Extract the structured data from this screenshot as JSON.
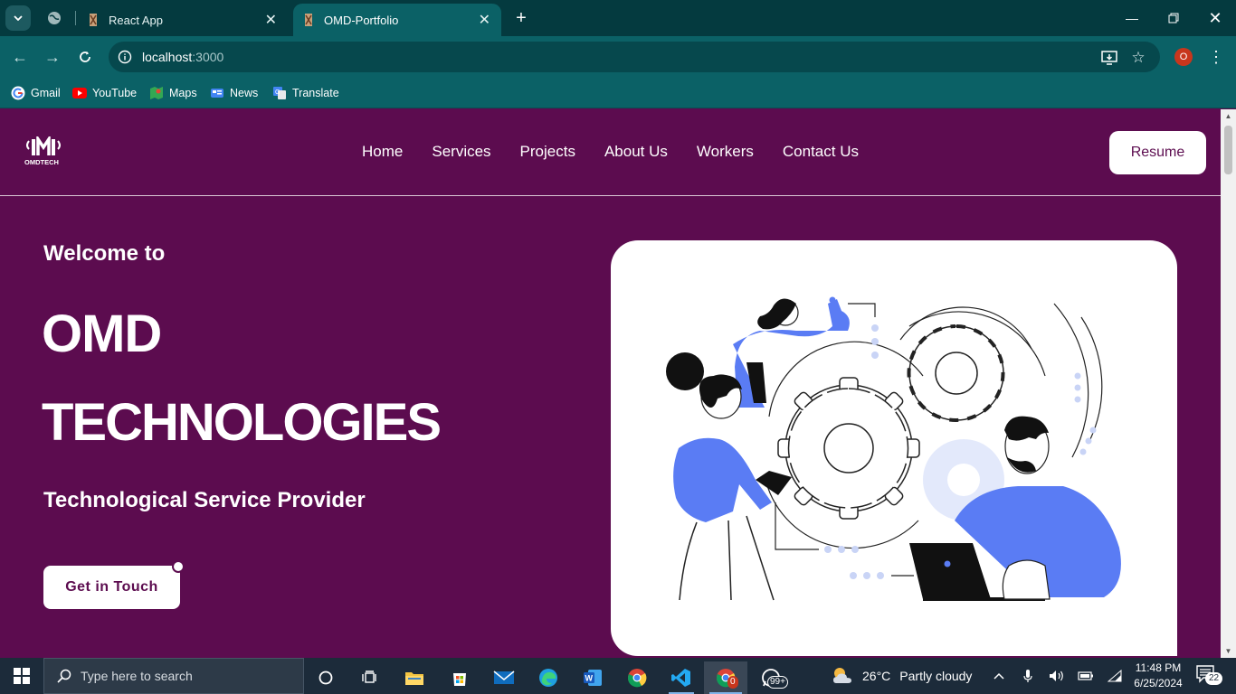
{
  "browser": {
    "tabs": [
      {
        "title": "React App",
        "active": false
      },
      {
        "title": "OMD-Portfolio",
        "active": true
      }
    ],
    "url_host": "localhost",
    "url_port": ":3000",
    "profile_initial": "O",
    "bookmarks": [
      {
        "label": "Gmail",
        "icon": "gmail-icon"
      },
      {
        "label": "YouTube",
        "icon": "youtube-icon"
      },
      {
        "label": "Maps",
        "icon": "maps-icon"
      },
      {
        "label": "News",
        "icon": "news-icon"
      },
      {
        "label": "Translate",
        "icon": "translate-icon"
      }
    ]
  },
  "site": {
    "logo_text": "OMDTECH",
    "nav": [
      "Home",
      "Services",
      "Projects",
      "About Us",
      "Workers",
      "Contact Us"
    ],
    "resume_label": "Resume",
    "hero": {
      "welcome": "Welcome to",
      "title_line1": "OMD",
      "title_line2": "TECHNOLOGIES",
      "subtitle": "Technological Service Provider",
      "cta_label": "Get in Touch"
    },
    "colors": {
      "primary": "#5c0c4f",
      "illustration_accent": "#5a7cf4"
    }
  },
  "taskbar": {
    "search_placeholder": "Type here to search",
    "weather_temp": "26°C",
    "weather_desc": "Partly cloudy",
    "time": "11:48 PM",
    "date": "6/25/2024",
    "chrome_badge": "0",
    "whatsapp_badge": "99+",
    "notifications_count": "22"
  }
}
